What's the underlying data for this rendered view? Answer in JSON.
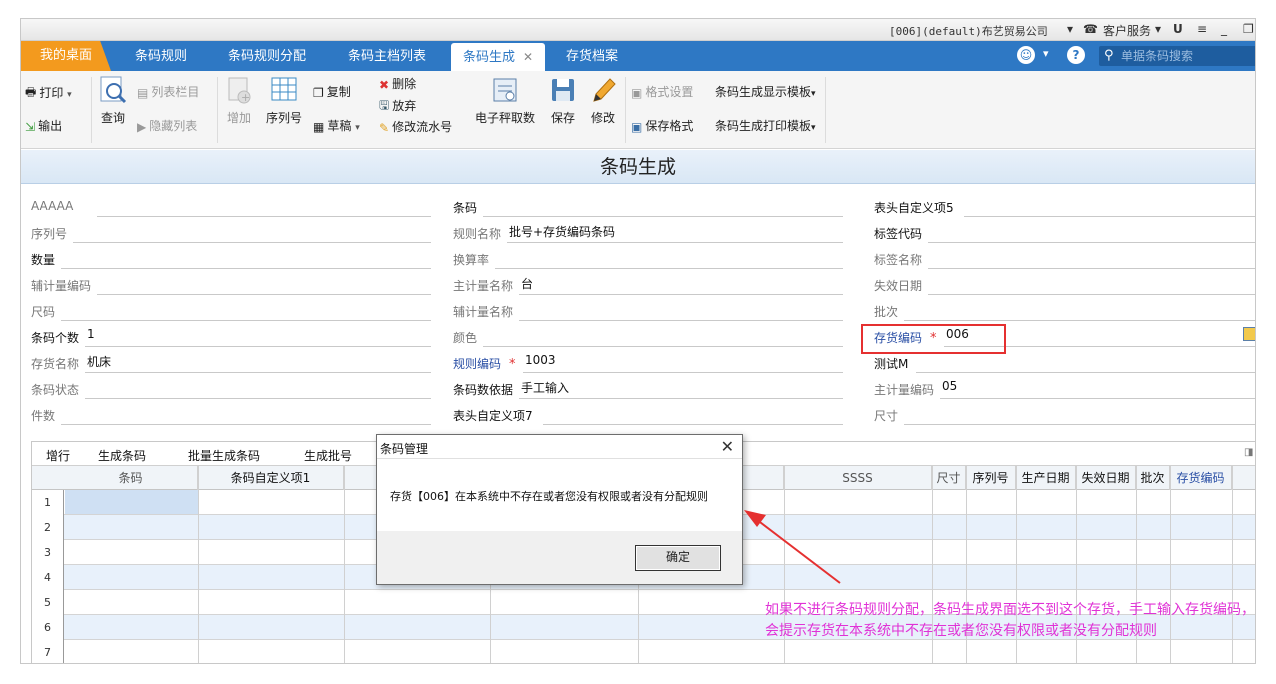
{
  "titlebar": {
    "company": "[006](default)布艺贸易公司",
    "service": "客户服务",
    "u_label": "U"
  },
  "tabs": [
    {
      "label": "我的桌面",
      "kind": "home"
    },
    {
      "label": "条码规则",
      "kind": "normal"
    },
    {
      "label": "条码规则分配",
      "kind": "normal"
    },
    {
      "label": "条码主档列表",
      "kind": "normal"
    },
    {
      "label": "条码生成",
      "kind": "active"
    },
    {
      "label": "存货档案",
      "kind": "normal"
    }
  ],
  "search": {
    "placeholder": "单据条码搜索"
  },
  "toolbar": {
    "print": "打印",
    "export": "输出",
    "query": "查询",
    "list_columns": "列表栏目",
    "hide_list": "隐藏列表",
    "add": "增加",
    "serial": "序列号",
    "copy": "复制",
    "draft": "草稿",
    "delete": "删除",
    "discard": "放弃",
    "modify_serial": "修改流水号",
    "scale": "电子秤取数",
    "save": "保存",
    "edit": "修改",
    "format_settings": "格式设置",
    "save_format": "保存格式",
    "display_template": "条码生成显示模板",
    "print_template": "条码生成打印模板"
  },
  "page_title": "条码生成",
  "form": {
    "col1": [
      {
        "label": "AAAAA",
        "value": ""
      },
      {
        "label": "序列号",
        "value": ""
      },
      {
        "label": "数量",
        "value": ""
      },
      {
        "label": "辅计量编码",
        "value": ""
      },
      {
        "label": "尺码",
        "value": ""
      },
      {
        "label": "条码个数",
        "value": "1"
      },
      {
        "label": "存货名称",
        "value": "机床"
      },
      {
        "label": "条码状态",
        "value": ""
      },
      {
        "label": "件数",
        "value": ""
      }
    ],
    "col2": [
      {
        "label": "条码",
        "value": ""
      },
      {
        "label": "规则名称",
        "value": "批号+存货编码条码"
      },
      {
        "label": "换算率",
        "value": ""
      },
      {
        "label": "主计量名称",
        "value": "台"
      },
      {
        "label": "辅计量名称",
        "value": ""
      },
      {
        "label": "颜色",
        "value": ""
      },
      {
        "label": "规则编码",
        "value": "1003"
      },
      {
        "label": "条码数依据",
        "value": "手工输入"
      },
      {
        "label": "表头自定义项7",
        "value": ""
      }
    ],
    "col3": [
      {
        "label": "表头自定义项5",
        "value": ""
      },
      {
        "label": "标签代码",
        "value": ""
      },
      {
        "label": "标签名称",
        "value": ""
      },
      {
        "label": "失效日期",
        "value": ""
      },
      {
        "label": "批次",
        "value": ""
      },
      {
        "label": "存货编码",
        "value": "006"
      },
      {
        "label": "测试M",
        "value": ""
      },
      {
        "label": "主计量编码",
        "value": "05"
      },
      {
        "label": "尺寸",
        "value": ""
      }
    ]
  },
  "grid": {
    "tools": [
      "增行",
      "生成条码",
      "批量生成条码",
      "生成批号"
    ],
    "columns": [
      "条码",
      "条码自定义项1",
      "SSSS",
      "尺寸",
      "序列号",
      "生产日期",
      "失效日期",
      "批次",
      "存货编码"
    ],
    "rows": [
      "1",
      "2",
      "3",
      "4",
      "5",
      "6",
      "7"
    ]
  },
  "dialog": {
    "title": "条码管理",
    "message": "存货【006】在本系统中不存在或者您没有权限或者没有分配规则",
    "ok": "确定"
  },
  "annotation": "如果不进行条码规则分配，条码生成界面选不到这个存货，手工输入存货编码，会提示存货在本系统中不存在或者您没有权限或者没有分配规则"
}
